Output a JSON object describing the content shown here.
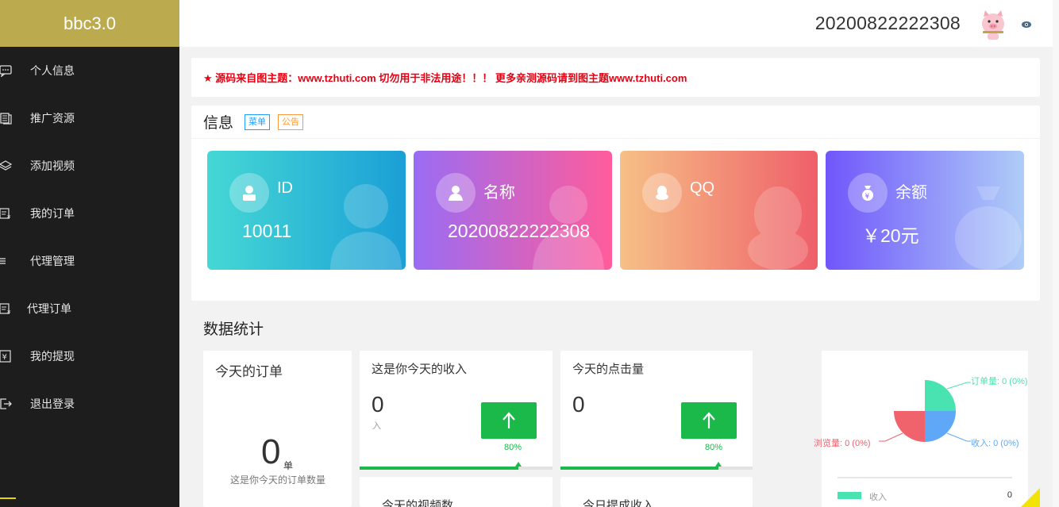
{
  "sidebar": {
    "brand": "bbc3.0",
    "items": [
      {
        "label": "个人信息",
        "icon": "chat-icon"
      },
      {
        "label": "推广资源",
        "icon": "stack-icon"
      },
      {
        "label": "添加视频",
        "icon": "layers-icon"
      },
      {
        "label": "我的订单",
        "icon": "order-icon"
      },
      {
        "label": "代理管理",
        "icon": "list-icon"
      },
      {
        "label": "代理订单",
        "icon": "order-icon"
      },
      {
        "label": "我的提现",
        "icon": "withdraw-icon"
      },
      {
        "label": "退出登录",
        "icon": "logout-icon"
      }
    ]
  },
  "header": {
    "username": "20200822222308",
    "avatar_icon": "pig-avatar-icon",
    "menu_icon": "eye-icon"
  },
  "notice": {
    "text": "★ 源码来自图主题：www.tzhuti.com 切勿用于非法用途！！！ 更多亲测源码请到图主题www.tzhuti.com",
    "color": "#e60012"
  },
  "info": {
    "title": "信息",
    "tags": [
      "菜单",
      "公告"
    ],
    "tiles": [
      {
        "label": "ID",
        "value": "10011",
        "icon": "user-icon"
      },
      {
        "label": "名称",
        "value": "20200822222308",
        "icon": "person-icon"
      },
      {
        "label": "QQ",
        "value": "",
        "icon": "qq-icon"
      },
      {
        "label": "余额",
        "value": "￥20元",
        "icon": "money-bag-icon"
      }
    ]
  },
  "stats": {
    "title": "数据统计",
    "orders_today": {
      "title": "今天的订单",
      "value": "0",
      "unit": "单",
      "caption": "这是你今天的订单数量"
    },
    "income_today": {
      "title": "这是你今天的收入",
      "value": "0",
      "sub": "入",
      "percent": "80%",
      "progress": 0.8
    },
    "clicks_today": {
      "title": "今天的点击量",
      "value": "0",
      "percent": "80%",
      "progress": 0.8
    },
    "videos_today": {
      "title": "今天的视频数"
    },
    "withdraw_today": {
      "title": "今日提成收入"
    }
  },
  "chart_data": {
    "type": "pie",
    "slices": [
      {
        "name": "订单量",
        "value": 0,
        "label": "订单量: 0 (0%)",
        "color": "#48e3b0"
      },
      {
        "name": "收入",
        "value": 0,
        "label": "收入: 0 (0%)",
        "color": "#5ea8f7"
      },
      {
        "name": "浏览量",
        "value": 0,
        "label": "浏览量: 0 (0%)",
        "color": "#f0626c"
      }
    ],
    "legend": [
      {
        "name": "收入",
        "value": "0"
      }
    ],
    "legend_position": "bottom"
  }
}
